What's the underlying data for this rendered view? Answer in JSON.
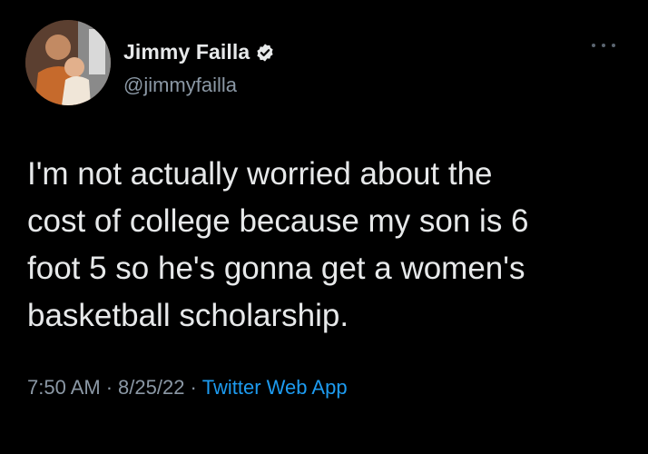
{
  "tweet": {
    "author": {
      "display_name": "Jimmy Failla",
      "handle": "@jimmyfailla",
      "verified": true,
      "avatar": "profile-photo"
    },
    "text": "I'm not actually worried about the\ncost of college because my son is 6\nfoot 5 so he's gonna get a women's\nbasketball scholarship.",
    "time": "7:50 AM",
    "date": "8/25/22",
    "separator": "·",
    "source": "Twitter Web App"
  },
  "colors": {
    "background": "#000000",
    "text_primary": "#e7e9ea",
    "text_secondary": "#8b98a5",
    "accent": "#1d9bf0"
  },
  "icons": {
    "more": "more-options-icon",
    "verified": "verified-badge-icon"
  }
}
